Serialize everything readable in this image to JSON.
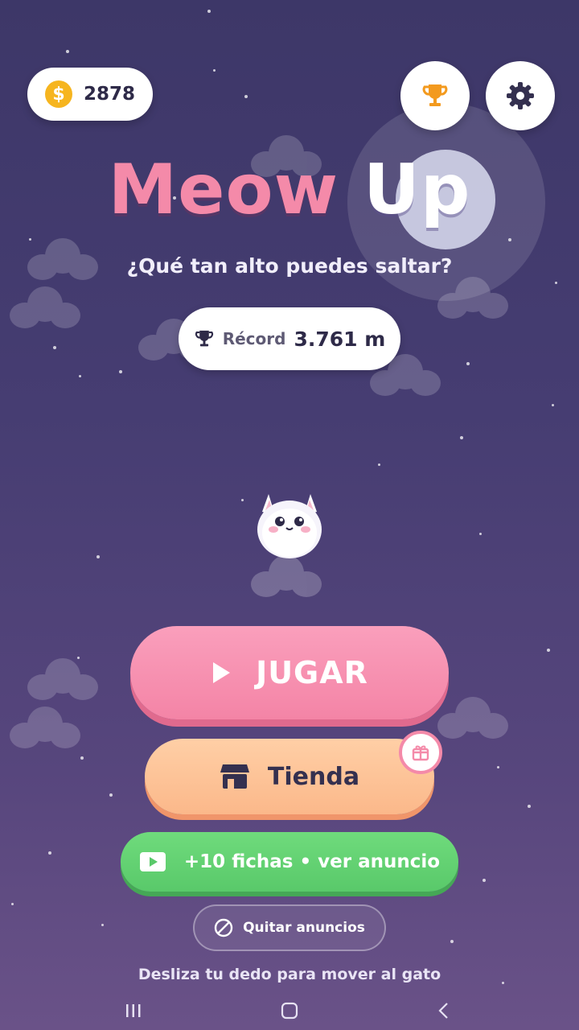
{
  "header": {
    "coins": "2878"
  },
  "title": {
    "part1": "Meow",
    "part2": "Up",
    "subtitle": "¿Qué tan alto puedes saltar?"
  },
  "record": {
    "label": "Récord",
    "value": "3.761 m"
  },
  "buttons": {
    "play_label": "JUGAR",
    "shop_label": "Tienda",
    "ad_label": "+10 fichas • ver anuncio",
    "remove_ads_label": "Quitar anuncios"
  },
  "hint": "Desliza tu dedo para mover al gato",
  "colors": {
    "title_pink": "#f48aa9",
    "play_pink": "#f78fb0",
    "shop_peach": "#fcc296",
    "ad_green": "#62d272",
    "coin_gold": "#f6b51f",
    "trophy_orange": "#f39a1e"
  },
  "icons": [
    "coin-icon",
    "trophy-icon",
    "gear-icon",
    "play-icon",
    "store-icon",
    "gift-icon",
    "video-icon",
    "block-icon",
    "recents-icon",
    "home-icon",
    "back-icon"
  ]
}
